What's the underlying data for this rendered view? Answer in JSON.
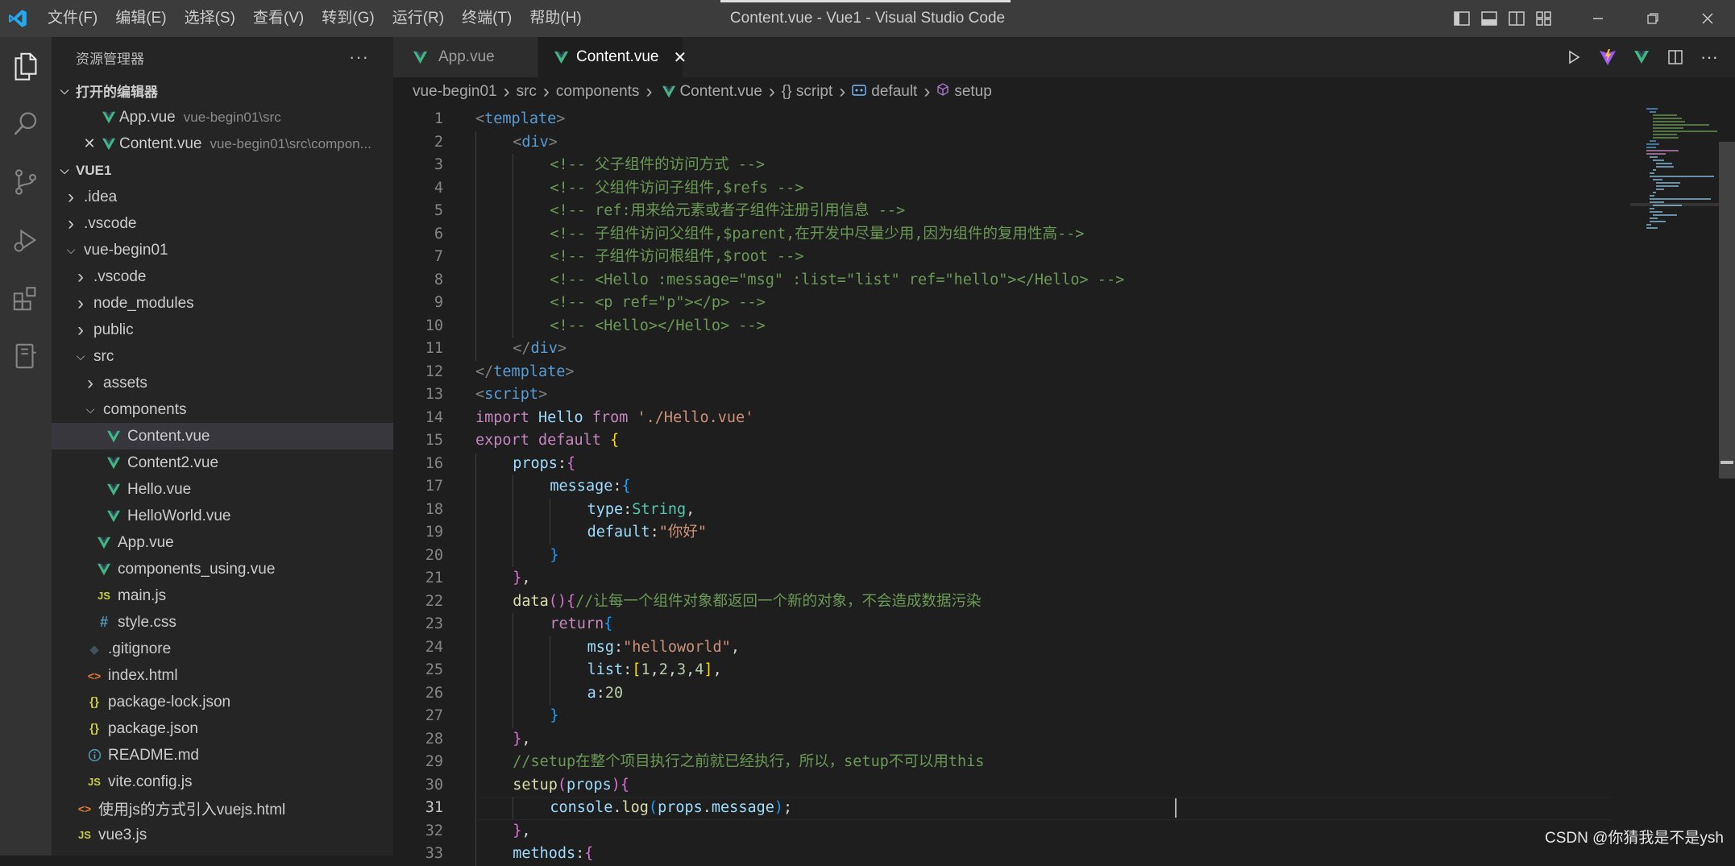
{
  "window": {
    "title": "Content.vue - Vue1 - Visual Studio Code",
    "menu": [
      "文件(F)",
      "编辑(E)",
      "选择(S)",
      "查看(V)",
      "转到(G)",
      "运行(R)",
      "终端(T)",
      "帮助(H)"
    ]
  },
  "sidebar": {
    "header": "资源管理器",
    "more_label": "···",
    "open_editors_title": "打开的编辑器",
    "open_editors": [
      {
        "name": "App.vue",
        "path": "vue-begin01\\src"
      },
      {
        "name": "Content.vue",
        "path": "vue-begin01\\src\\compon..."
      }
    ],
    "workspace_title": "VUE1",
    "tree": [
      {
        "label": ".idea",
        "kind": "folder",
        "depth": 1
      },
      {
        "label": ".vscode",
        "kind": "folder",
        "depth": 1
      },
      {
        "label": "vue-begin01",
        "kind": "folder-open",
        "depth": 1
      },
      {
        "label": ".vscode",
        "kind": "folder",
        "depth": 2
      },
      {
        "label": "node_modules",
        "kind": "folder",
        "depth": 2
      },
      {
        "label": "public",
        "kind": "folder",
        "depth": 2
      },
      {
        "label": "src",
        "kind": "folder-open",
        "depth": 2
      },
      {
        "label": "assets",
        "kind": "folder",
        "depth": 3
      },
      {
        "label": "components",
        "kind": "folder-open",
        "depth": 3
      },
      {
        "label": "Content.vue",
        "kind": "vue",
        "depth": 4,
        "active": true
      },
      {
        "label": "Content2.vue",
        "kind": "vue",
        "depth": 4
      },
      {
        "label": "Hello.vue",
        "kind": "vue",
        "depth": 4
      },
      {
        "label": "HelloWorld.vue",
        "kind": "vue",
        "depth": 4
      },
      {
        "label": "App.vue",
        "kind": "vue",
        "depth": 3
      },
      {
        "label": "components_using.vue",
        "kind": "vue",
        "depth": 3
      },
      {
        "label": "main.js",
        "kind": "js",
        "depth": 3
      },
      {
        "label": "style.css",
        "kind": "css",
        "depth": 3
      },
      {
        "label": ".gitignore",
        "kind": "git",
        "depth": 2
      },
      {
        "label": "index.html",
        "kind": "html",
        "depth": 2
      },
      {
        "label": "package-lock.json",
        "kind": "json",
        "depth": 2
      },
      {
        "label": "package.json",
        "kind": "json",
        "depth": 2
      },
      {
        "label": "README.md",
        "kind": "info",
        "depth": 2
      },
      {
        "label": "vite.config.js",
        "kind": "js",
        "depth": 2
      },
      {
        "label": "使用js的方式引入vuejs.html",
        "kind": "html",
        "depth": 1
      },
      {
        "label": "vue3.js",
        "kind": "js",
        "depth": 1
      }
    ]
  },
  "tabs": [
    {
      "label": "App.vue",
      "active": false
    },
    {
      "label": "Content.vue",
      "active": true
    }
  ],
  "breadcrumbs": [
    "vue-begin01",
    "src",
    "components",
    "Content.vue",
    "{} script",
    "default",
    "setup"
  ],
  "code": [
    {
      "n": 1,
      "indent": 0,
      "tokens": [
        [
          "<",
          "br"
        ],
        [
          "template",
          "tag"
        ],
        [
          ">",
          "br"
        ]
      ]
    },
    {
      "n": 2,
      "indent": 1,
      "tokens": [
        [
          "<",
          "br"
        ],
        [
          "div",
          "tag"
        ],
        [
          ">",
          "br"
        ]
      ]
    },
    {
      "n": 3,
      "indent": 2,
      "tokens": [
        [
          "<!-- 父子组件的访问方式 -->",
          "com"
        ]
      ]
    },
    {
      "n": 4,
      "indent": 2,
      "tokens": [
        [
          "<!-- 父组件访问子组件,$refs -->",
          "com"
        ]
      ]
    },
    {
      "n": 5,
      "indent": 2,
      "tokens": [
        [
          "<!-- ref:用来给元素或者子组件注册引用信息 -->",
          "com"
        ]
      ]
    },
    {
      "n": 6,
      "indent": 2,
      "tokens": [
        [
          "<!-- 子组件访问父组件,$parent,在开发中尽量少用,因为组件的复用性高-->",
          "com"
        ]
      ]
    },
    {
      "n": 7,
      "indent": 2,
      "tokens": [
        [
          "<!-- 子组件访问根组件,$root -->",
          "com"
        ]
      ]
    },
    {
      "n": 8,
      "indent": 2,
      "tokens": [
        [
          "<!-- <Hello :message=\"msg\" :list=\"list\" ref=\"hello\"></Hello> -->",
          "com"
        ]
      ]
    },
    {
      "n": 9,
      "indent": 2,
      "tokens": [
        [
          "<!-- <p ref=\"p\"></p> -->",
          "com"
        ]
      ]
    },
    {
      "n": 10,
      "indent": 2,
      "tokens": [
        [
          "<!-- <Hello></Hello> -->",
          "com"
        ]
      ]
    },
    {
      "n": 11,
      "indent": 1,
      "tokens": [
        [
          "</",
          "br"
        ],
        [
          "div",
          "tag"
        ],
        [
          ">",
          "br"
        ]
      ]
    },
    {
      "n": 12,
      "indent": 0,
      "tokens": [
        [
          "</",
          "br"
        ],
        [
          "template",
          "tag"
        ],
        [
          ">",
          "br"
        ]
      ]
    },
    {
      "n": 13,
      "indent": 0,
      "tokens": [
        [
          "<",
          "br"
        ],
        [
          "script",
          "tag"
        ],
        [
          ">",
          "br"
        ]
      ]
    },
    {
      "n": 14,
      "indent": 0,
      "tokens": [
        [
          "import",
          "kw"
        ],
        [
          " ",
          "pl"
        ],
        [
          "Hello",
          "id"
        ],
        [
          " ",
          "pl"
        ],
        [
          "from",
          "kw"
        ],
        [
          " ",
          "pl"
        ],
        [
          "'./Hello.vue'",
          "str"
        ]
      ]
    },
    {
      "n": 15,
      "indent": 0,
      "tokens": [
        [
          "export",
          "kw"
        ],
        [
          " ",
          "pl"
        ],
        [
          "default",
          "kw"
        ],
        [
          " ",
          "pl"
        ],
        [
          "{",
          "y"
        ]
      ]
    },
    {
      "n": 16,
      "indent": 1,
      "tokens": [
        [
          "props",
          "id"
        ],
        [
          ":",
          "pl"
        ],
        [
          "{",
          "p"
        ]
      ]
    },
    {
      "n": 17,
      "indent": 2,
      "tokens": [
        [
          "message",
          "id"
        ],
        [
          ":",
          "pl"
        ],
        [
          "{",
          "b"
        ]
      ]
    },
    {
      "n": 18,
      "indent": 3,
      "tokens": [
        [
          "type",
          "id"
        ],
        [
          ":",
          "pl"
        ],
        [
          "String",
          "type"
        ],
        [
          ",",
          "pl"
        ]
      ]
    },
    {
      "n": 19,
      "indent": 3,
      "tokens": [
        [
          "default",
          "id"
        ],
        [
          ":",
          "pl"
        ],
        [
          "\"你好\"",
          "str"
        ]
      ]
    },
    {
      "n": 20,
      "indent": 2,
      "tokens": [
        [
          "}",
          "b"
        ]
      ]
    },
    {
      "n": 21,
      "indent": 1,
      "tokens": [
        [
          "}",
          "p"
        ],
        [
          ",",
          "pl"
        ]
      ]
    },
    {
      "n": 22,
      "indent": 1,
      "tokens": [
        [
          "data",
          "fn"
        ],
        [
          "()",
          "p"
        ],
        [
          "{",
          "p"
        ],
        [
          "//让每一个组件对象都返回一个新的对象，不会造成数据污染",
          "com"
        ]
      ]
    },
    {
      "n": 23,
      "indent": 2,
      "tokens": [
        [
          "return",
          "kw"
        ],
        [
          "{",
          "b"
        ]
      ]
    },
    {
      "n": 24,
      "indent": 3,
      "tokens": [
        [
          "msg",
          "id"
        ],
        [
          ":",
          "pl"
        ],
        [
          "\"helloworld\"",
          "str"
        ],
        [
          ",",
          "pl"
        ]
      ]
    },
    {
      "n": 25,
      "indent": 3,
      "tokens": [
        [
          "list",
          "id"
        ],
        [
          ":",
          "pl"
        ],
        [
          "[",
          "y"
        ],
        [
          "1",
          "num"
        ],
        [
          ",",
          "pl"
        ],
        [
          "2",
          "num"
        ],
        [
          ",",
          "pl"
        ],
        [
          "3",
          "num"
        ],
        [
          ",",
          "pl"
        ],
        [
          "4",
          "num"
        ],
        [
          "]",
          "y"
        ],
        [
          ",",
          "pl"
        ]
      ]
    },
    {
      "n": 26,
      "indent": 3,
      "tokens": [
        [
          "a",
          "id"
        ],
        [
          ":",
          "pl"
        ],
        [
          "20",
          "num"
        ]
      ]
    },
    {
      "n": 27,
      "indent": 2,
      "tokens": [
        [
          "}",
          "b"
        ]
      ]
    },
    {
      "n": 28,
      "indent": 1,
      "tokens": [
        [
          "}",
          "p"
        ],
        [
          ",",
          "pl"
        ]
      ]
    },
    {
      "n": 29,
      "indent": 1,
      "tokens": [
        [
          "//setup在整个项目执行之前就已经执行，所以，setup不可以用this",
          "com"
        ]
      ]
    },
    {
      "n": 30,
      "indent": 1,
      "tokens": [
        [
          "setup",
          "fn"
        ],
        [
          "(",
          "p"
        ],
        [
          "props",
          "id"
        ],
        [
          ")",
          "p"
        ],
        [
          "{",
          "p"
        ]
      ]
    },
    {
      "n": 31,
      "indent": 2,
      "tokens": [
        [
          "console",
          "id"
        ],
        [
          ".",
          "pl"
        ],
        [
          "log",
          "fn"
        ],
        [
          "(",
          "b"
        ],
        [
          "props",
          "id"
        ],
        [
          ".",
          "pl"
        ],
        [
          "message",
          "id"
        ],
        [
          ")",
          "b"
        ],
        [
          ";",
          "pl"
        ]
      ],
      "current": true
    },
    {
      "n": 32,
      "indent": 1,
      "tokens": [
        [
          "}",
          "p"
        ],
        [
          ",",
          "pl"
        ]
      ]
    },
    {
      "n": 33,
      "indent": 1,
      "tokens": [
        [
          "methods",
          "id"
        ],
        [
          ":",
          "pl"
        ],
        [
          "{",
          "p"
        ]
      ]
    }
  ],
  "watermark": "CSDN @你猜我是不是ysh",
  "colors": {
    "vue_green": "#41b883",
    "js_yellow": "#cbcb41",
    "css_blue": "#519aba",
    "html_orange": "#e37933",
    "activity_icon": "#858585"
  }
}
